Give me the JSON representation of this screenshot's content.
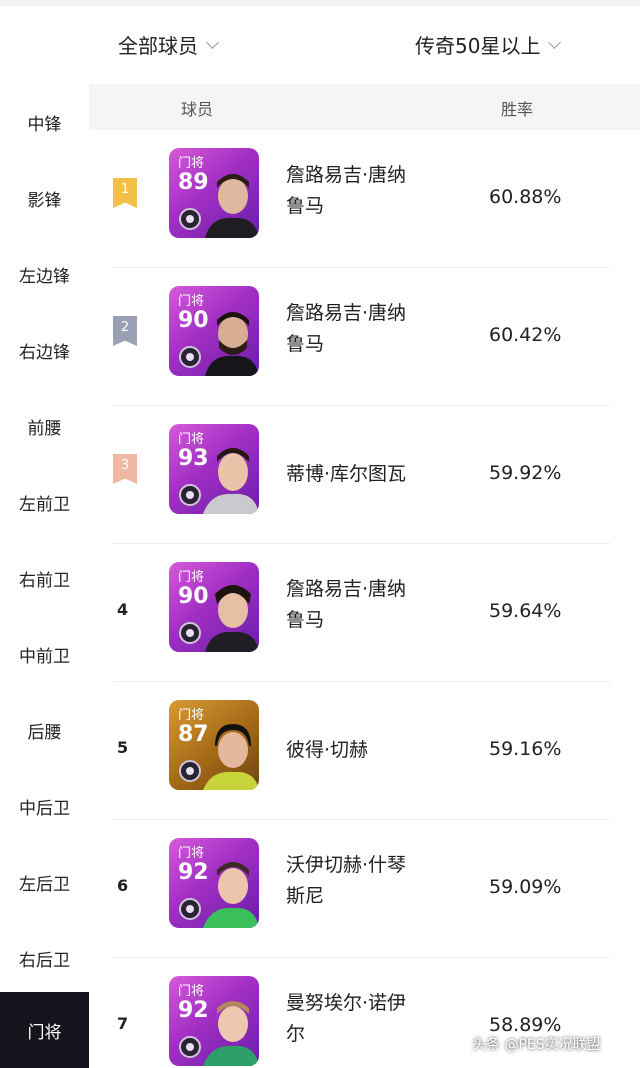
{
  "filters": {
    "scope_label": "全部球员",
    "rank_label": "传奇50星以上"
  },
  "sidebar": {
    "items": [
      {
        "label": "中锋"
      },
      {
        "label": "影锋"
      },
      {
        "label": "左边锋"
      },
      {
        "label": "右边锋"
      },
      {
        "label": "前腰"
      },
      {
        "label": "左前卫"
      },
      {
        "label": "右前卫"
      },
      {
        "label": "中前卫"
      },
      {
        "label": "后腰"
      },
      {
        "label": "中后卫"
      },
      {
        "label": "左后卫"
      },
      {
        "label": "右后卫"
      },
      {
        "label": "门将",
        "active": true
      }
    ]
  },
  "table": {
    "col_player": "球员",
    "col_winrate": "胜率",
    "rows": [
      {
        "rank": "1",
        "position": "门将",
        "overall": "89",
        "name_line1": "詹路易吉·唐纳",
        "name_line2": "鲁马",
        "winrate": "60.88%",
        "card_color": "#a12fc4"
      },
      {
        "rank": "2",
        "position": "门将",
        "overall": "90",
        "name_line1": "詹路易吉·唐纳",
        "name_line2": "鲁马",
        "winrate": "60.42%",
        "card_color": "#a12fc4"
      },
      {
        "rank": "3",
        "position": "门将",
        "overall": "93",
        "name_line1": "蒂博·库尔图瓦",
        "name_line2": "",
        "winrate": "59.92%",
        "card_color": "#a12fc4"
      },
      {
        "rank": "4",
        "position": "门将",
        "overall": "90",
        "name_line1": "詹路易吉·唐纳",
        "name_line2": "鲁马",
        "winrate": "59.64%",
        "card_color": "#a12fc4"
      },
      {
        "rank": "5",
        "position": "门将",
        "overall": "87",
        "name_line1": "彼得·切赫",
        "name_line2": "",
        "winrate": "59.16%",
        "card_color": "#a86d18"
      },
      {
        "rank": "6",
        "position": "门将",
        "overall": "92",
        "name_line1": "沃伊切赫·什琴",
        "name_line2": "斯尼",
        "winrate": "59.09%",
        "card_color": "#a12fc4"
      },
      {
        "rank": "7",
        "position": "门将",
        "overall": "92",
        "name_line1": "曼努埃尔·诺伊",
        "name_line2": "尔",
        "winrate": "58.89%",
        "card_color": "#a12fc4"
      }
    ]
  },
  "watermark": "头条 @PES实况联盟"
}
